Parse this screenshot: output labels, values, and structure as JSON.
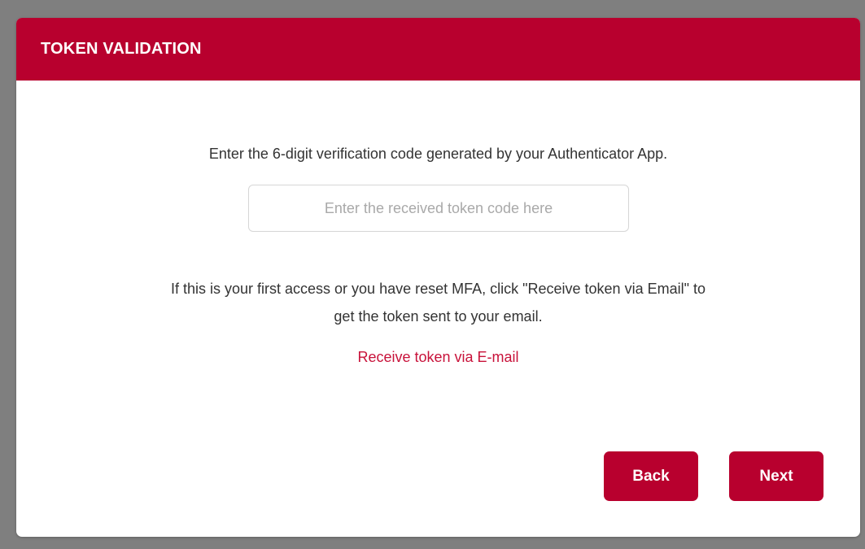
{
  "modal": {
    "title": "TOKEN VALIDATION",
    "instruction": "Enter the 6-digit verification code generated by your Authenticator App.",
    "token_input": {
      "value": "",
      "placeholder": "Enter the received token code here"
    },
    "info_line1": "If this is your first access or you have reset MFA, click \"Receive token via Email\" to",
    "info_line2": "get the token sent to your email.",
    "email_link_label": "Receive token via E-mail",
    "back_label": "Back",
    "next_label": "Next"
  },
  "colors": {
    "header_bg": "#b8002e",
    "button_bg": "#b8002e",
    "link": "#c8123a",
    "backdrop": "#7f7f7f"
  }
}
